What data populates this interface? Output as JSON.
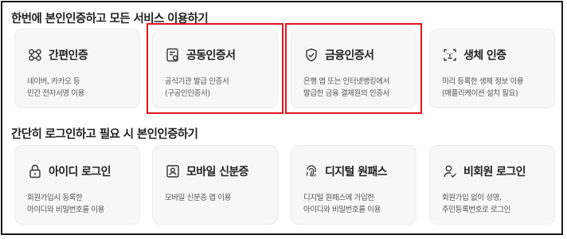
{
  "section1": {
    "title": "한번에 본인인증하고 모든 서비스 이용하기",
    "cards": [
      {
        "title": "간편인증",
        "icon": "simple-auth-icon",
        "desc": [
          "네이버, 카카오 등",
          "민간 전자서명 이용"
        ],
        "highlighted": false
      },
      {
        "title": "공동인증서",
        "icon": "certificate-icon",
        "desc": [
          "공식기관 발급 인증서",
          "(구공인인증서)"
        ],
        "highlighted": true
      },
      {
        "title": "금융인증서",
        "icon": "shield-check-icon",
        "desc": [
          "은행 앱 또는 인터넷뱅킹에서",
          "발급한 금융 결제원의 인증서"
        ],
        "highlighted": true
      },
      {
        "title": "생체 인증",
        "icon": "face-scan-icon",
        "desc": [
          "미리 등록한 생체 정보 이용",
          "(애플리케이션 설치 필요)"
        ],
        "highlighted": false
      }
    ]
  },
  "section2": {
    "title": "간단히 로그인하고 필요 시 본인인증하기",
    "cards": [
      {
        "title": "아이디 로그인",
        "icon": "lock-icon",
        "desc": [
          "회원가입시 등록한",
          "아이디와 비밀번호를 이용"
        ]
      },
      {
        "title": "모바일 신분증",
        "icon": "id-card-icon",
        "desc": [
          "모바일 신분증 앱 이용"
        ]
      },
      {
        "title": "디지털 원패스",
        "icon": "fingerprint-icon",
        "desc": [
          "디지털 원패스에 가입한",
          "아이디와 비밀번호를 이용"
        ]
      },
      {
        "title": "비회원 로그인",
        "icon": "user-check-icon",
        "desc": [
          "회원가입 없이 성명,",
          "주민등록번호로 로그인"
        ]
      }
    ]
  },
  "colors": {
    "highlight": "#e3141e",
    "card_bg": "#f7f7f8"
  }
}
